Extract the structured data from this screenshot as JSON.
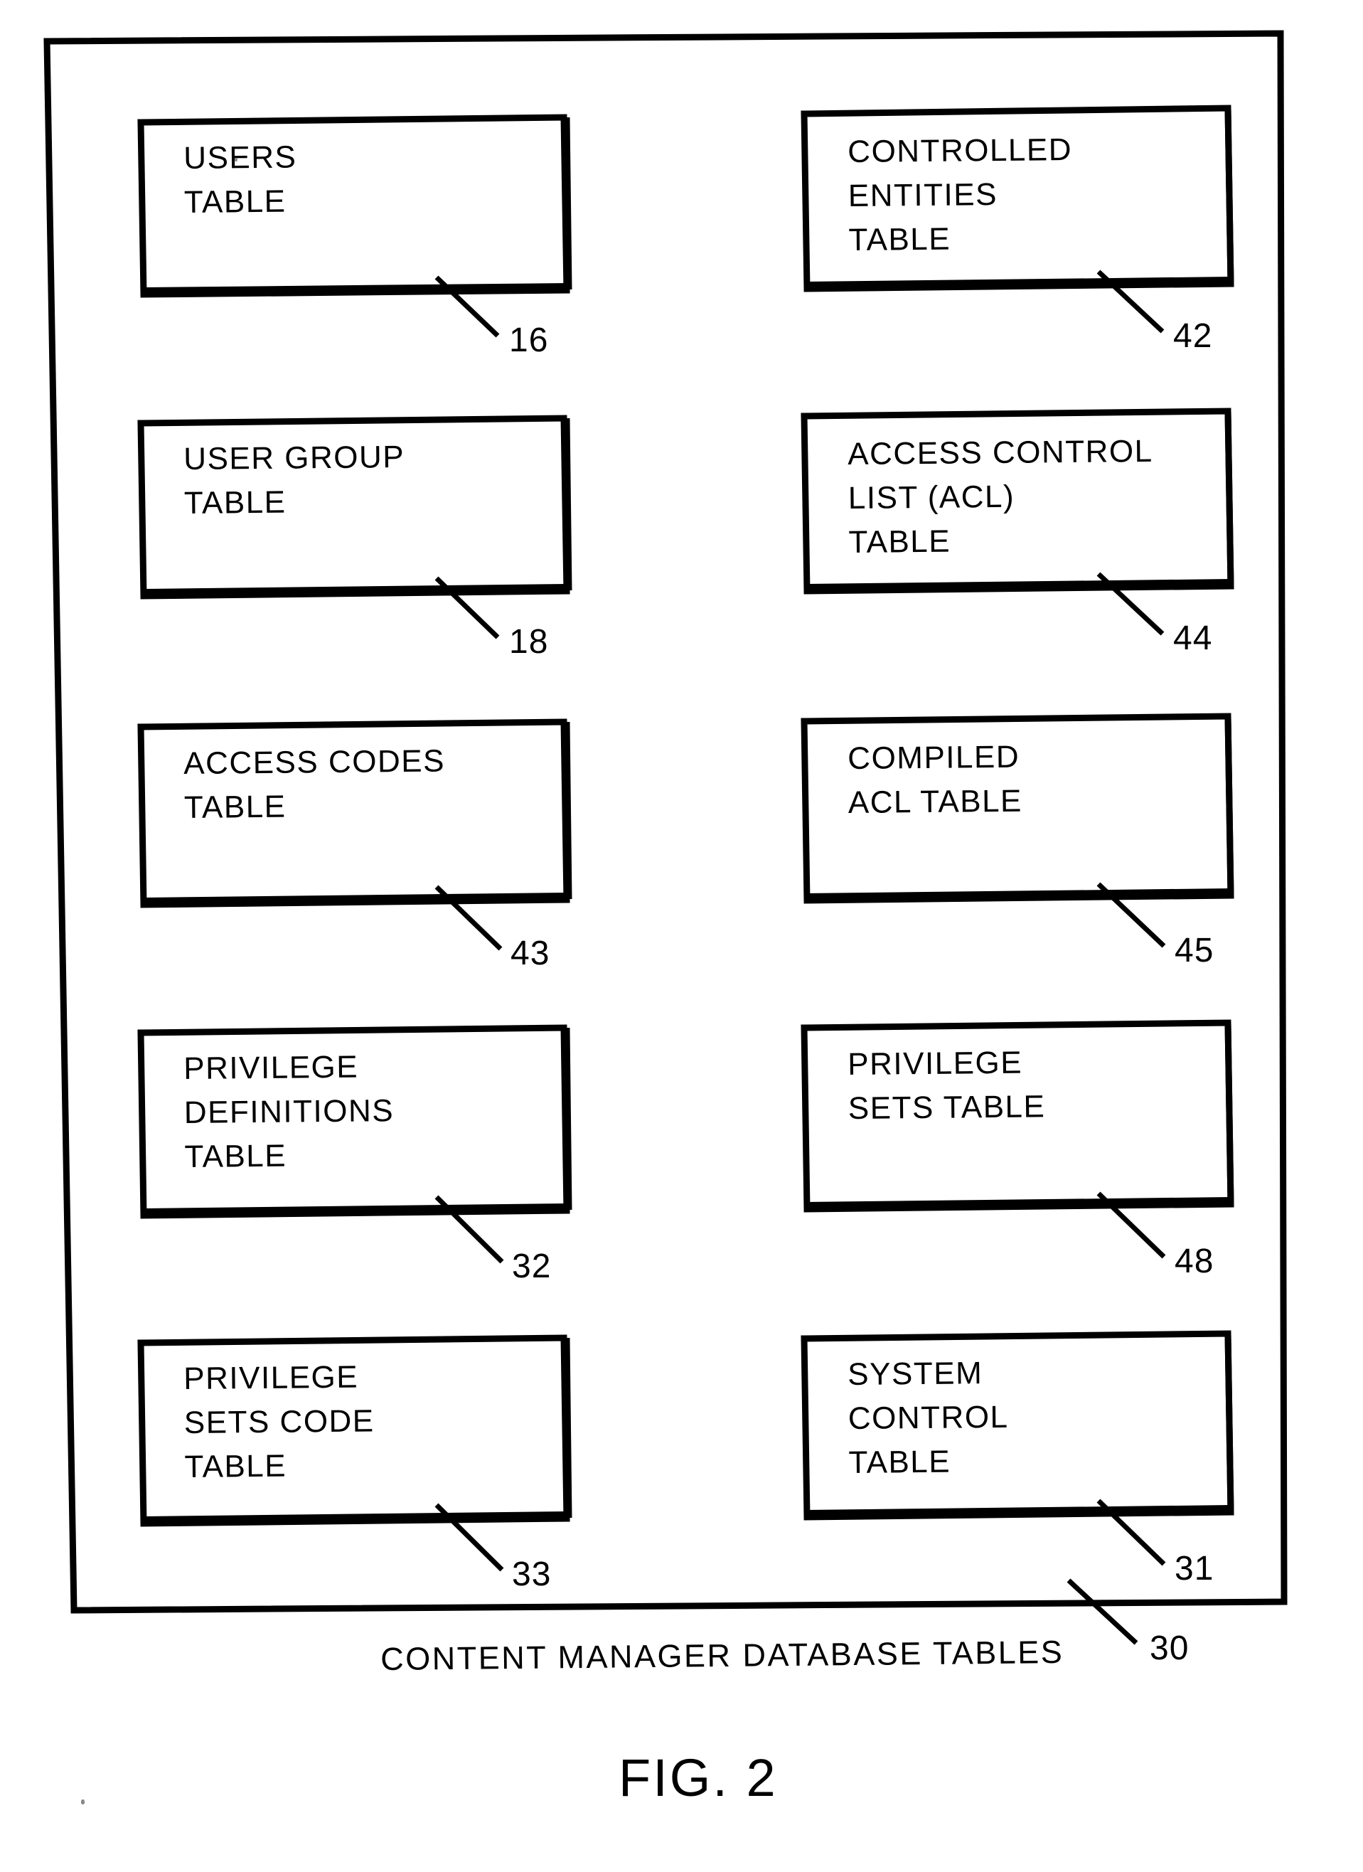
{
  "figure": {
    "label": "FIG. 2",
    "caption": "CONTENT MANAGER DATABASE TABLES",
    "caption_ref": "30",
    "outer_container_name": "content-manager-database-tables"
  },
  "colors": {
    "ink": "#000000",
    "background": "#ffffff"
  },
  "boxes": [
    {
      "id": "users-table",
      "column": "left",
      "row": 1,
      "lines": [
        "USERS",
        "TABLE"
      ],
      "ref": "16"
    },
    {
      "id": "controlled-entities-table",
      "column": "right",
      "row": 1,
      "lines": [
        "CONTROLLED",
        "ENTITIES",
        "TABLE"
      ],
      "ref": "42"
    },
    {
      "id": "user-group-table",
      "column": "left",
      "row": 2,
      "lines": [
        "USER GROUP",
        "TABLE"
      ],
      "ref": "18"
    },
    {
      "id": "access-control-list-acl-table",
      "column": "right",
      "row": 2,
      "lines": [
        "ACCESS CONTROL",
        "LIST (ACL)",
        "TABLE"
      ],
      "ref": "44"
    },
    {
      "id": "access-codes-table",
      "column": "left",
      "row": 3,
      "lines": [
        "ACCESS CODES",
        "TABLE"
      ],
      "ref": "43"
    },
    {
      "id": "compiled-acl-table",
      "column": "right",
      "row": 3,
      "lines": [
        "COMPILED",
        "ACL TABLE"
      ],
      "ref": "45"
    },
    {
      "id": "privilege-definitions-table",
      "column": "left",
      "row": 4,
      "lines": [
        "PRIVILEGE",
        "DEFINITIONS",
        "TABLE"
      ],
      "ref": "32"
    },
    {
      "id": "privilege-sets-table",
      "column": "right",
      "row": 4,
      "lines": [
        "PRIVILEGE",
        "SETS TABLE"
      ],
      "ref": "48"
    },
    {
      "id": "privilege-sets-code-table",
      "column": "left",
      "row": 5,
      "lines": [
        "PRIVILEGE",
        "SETS CODE",
        "TABLE"
      ],
      "ref": "33"
    },
    {
      "id": "system-control-table",
      "column": "right",
      "row": 5,
      "lines": [
        "SYSTEM",
        "CONTROL",
        "TABLE"
      ],
      "ref": "31"
    }
  ]
}
